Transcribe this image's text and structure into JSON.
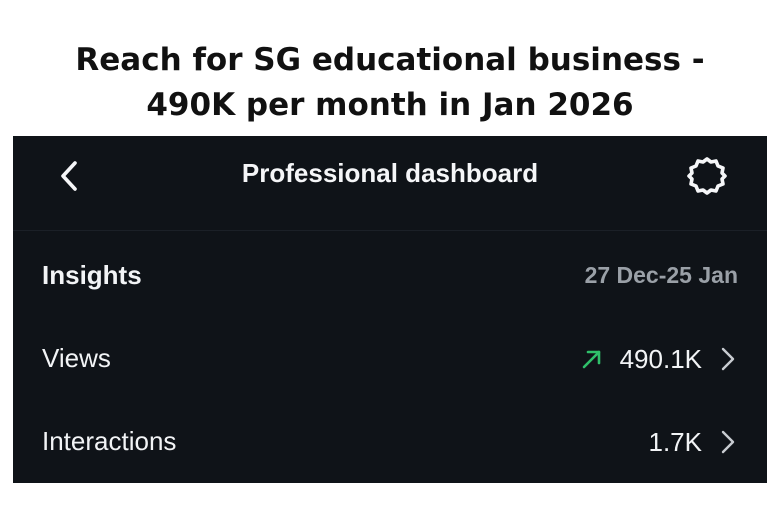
{
  "caption": {
    "line1": "Reach for SG educational business -",
    "line2": "490K per month in Jan 2026"
  },
  "header": {
    "title": "Professional dashboard",
    "back_icon": "chevron-left-icon",
    "settings_icon": "gear-icon"
  },
  "insights": {
    "title": "Insights",
    "date_range": "27 Dec-25 Jan",
    "metrics": [
      {
        "label": "Views",
        "value": "490.1K",
        "trend": "up",
        "trend_icon": "trend-up-arrow-icon"
      },
      {
        "label": "Interactions",
        "value": "1.7K"
      }
    ]
  },
  "colors": {
    "background": "#0f1318",
    "text": "#f2f4f6",
    "muted": "#9aa0a7",
    "trend_up": "#2fc06a"
  }
}
